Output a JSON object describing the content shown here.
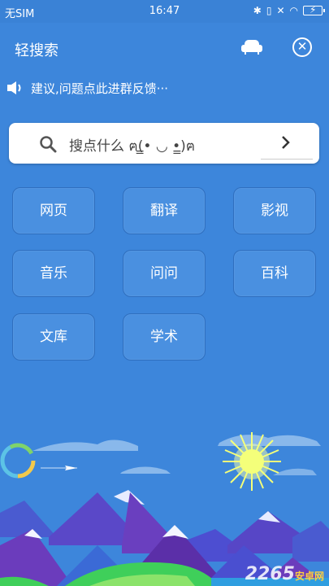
{
  "status_bar": {
    "carrier": "无SIM",
    "time": "16:47"
  },
  "app_bar": {
    "title": "轻搜索"
  },
  "notice": {
    "text": "建议,问题点此进群反馈···"
  },
  "search": {
    "placeholder": "搜点什么 ฅ(̳• ◡ •̳)ฅ"
  },
  "categories": [
    {
      "label": "网页"
    },
    {
      "label": "翻译"
    },
    {
      "label": "影视"
    },
    {
      "label": "音乐"
    },
    {
      "label": "问问"
    },
    {
      "label": "百科"
    },
    {
      "label": "文库"
    },
    {
      "label": "学术"
    }
  ],
  "watermark": {
    "text": "2265",
    "sub": "安卓网"
  },
  "colors": {
    "background": "#3d86db",
    "button_fill": "#4a90e0",
    "button_border": "#2f6fbf"
  }
}
